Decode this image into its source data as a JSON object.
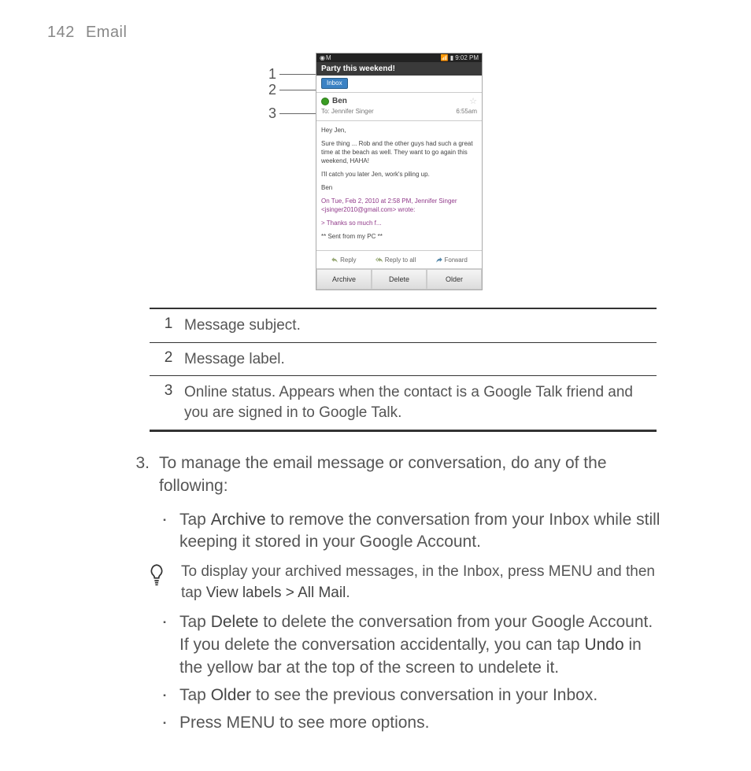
{
  "page": {
    "number": "142",
    "section": "Email"
  },
  "phone": {
    "statusbar": {
      "time": "9:02 PM"
    },
    "subject": "Party this weekend!",
    "label": "Inbox",
    "sender": "Ben",
    "to": "To: Jennifer Singer",
    "time": "6:55am",
    "body_greeting": "Hey Jen,",
    "body_p1": "Sure thing ... Rob and the other guys had such a great time at the beach as well. They want to go again this weekend, HAHA!",
    "body_p2": "I'll catch you later Jen, work's piling up.",
    "body_sign": "Ben",
    "quoted_header": "On Tue, Feb 2, 2010 at 2:58 PM, Jennifer Singer <jsinger2010@gmail.com> wrote:",
    "quoted_line": "> Thanks so much f...",
    "sent_from": "** Sent from my PC **",
    "reply": "Reply",
    "reply_all": "Reply to all",
    "forward": "Forward",
    "btn_archive": "Archive",
    "btn_delete": "Delete",
    "btn_older": "Older"
  },
  "callouts": {
    "c1": "1",
    "c2": "2",
    "c3": "3"
  },
  "legend": {
    "r1n": "1",
    "r1d": "Message subject.",
    "r2n": "2",
    "r2d": "Message label.",
    "r3n": "3",
    "r3d": "Online status. Appears when the contact is a Google Talk friend and you are signed in to Google Talk."
  },
  "step3": {
    "num": "3.",
    "text": "To manage the email message or conversation, do any of the following:"
  },
  "bullets": {
    "archive_a": "Tap ",
    "archive_b": "Archive",
    "archive_c": " to remove the conversation from your Inbox while still keeping it stored in your Google Account.",
    "tip_a": "To display your archived messages, in the Inbox, press MENU and then tap ",
    "tip_b": "View labels > All Mail",
    "tip_c": ".",
    "delete_a": "Tap ",
    "delete_b": "Delete",
    "delete_c": " to delete the conversation from your Google Account. If you delete the conversation accidentally, you can tap ",
    "delete_d": "Undo",
    "delete_e": " in the yellow bar at the top of the screen to undelete it.",
    "older_a": "Tap ",
    "older_b": "Older",
    "older_c": " to see the previous conversation in your Inbox.",
    "menu": "Press MENU to see more options."
  }
}
